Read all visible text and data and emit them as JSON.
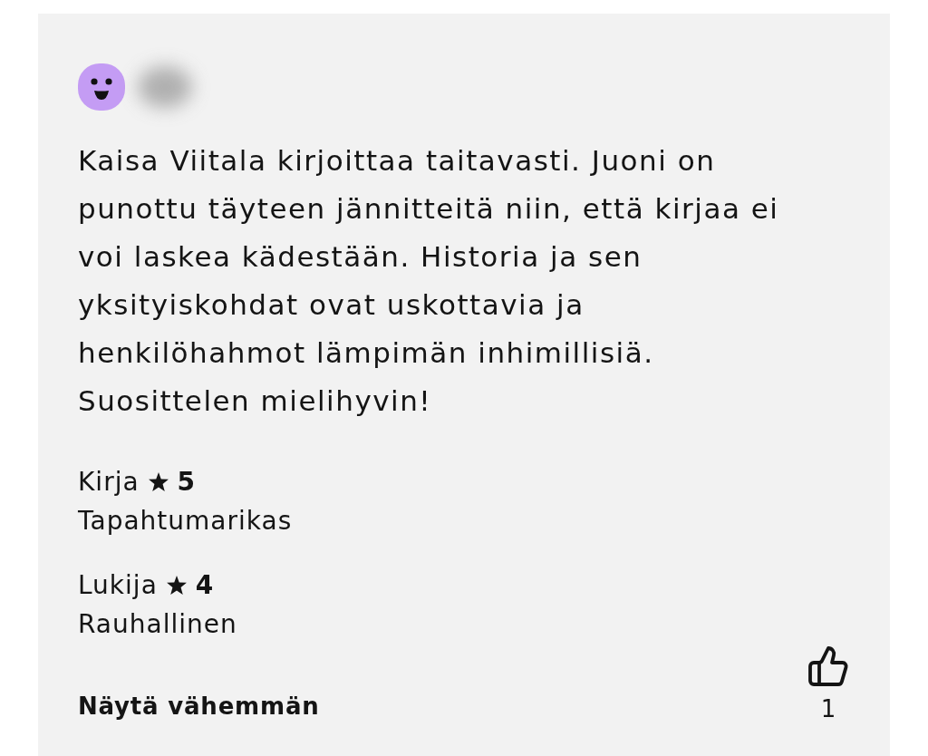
{
  "review": {
    "text": "Kaisa Viitala kirjoittaa taitavasti. Juoni on punottu täyteen jännitteitä niin, että kirjaa ei voi laskea kädestään. Historia ja sen yksityiskohdat ovat uskottavia ja henkilöhahmot lämpimän inhimillisiä. Suosittelen mielihyvin!",
    "ratings": [
      {
        "label": "Kirja",
        "score": "5",
        "descriptor": "Tapahtumarikas"
      },
      {
        "label": "Lukija",
        "score": "4",
        "descriptor": "Rauhallinen"
      }
    ],
    "toggle_link": "Näytä vähemmän",
    "likes": {
      "count": "1"
    }
  }
}
